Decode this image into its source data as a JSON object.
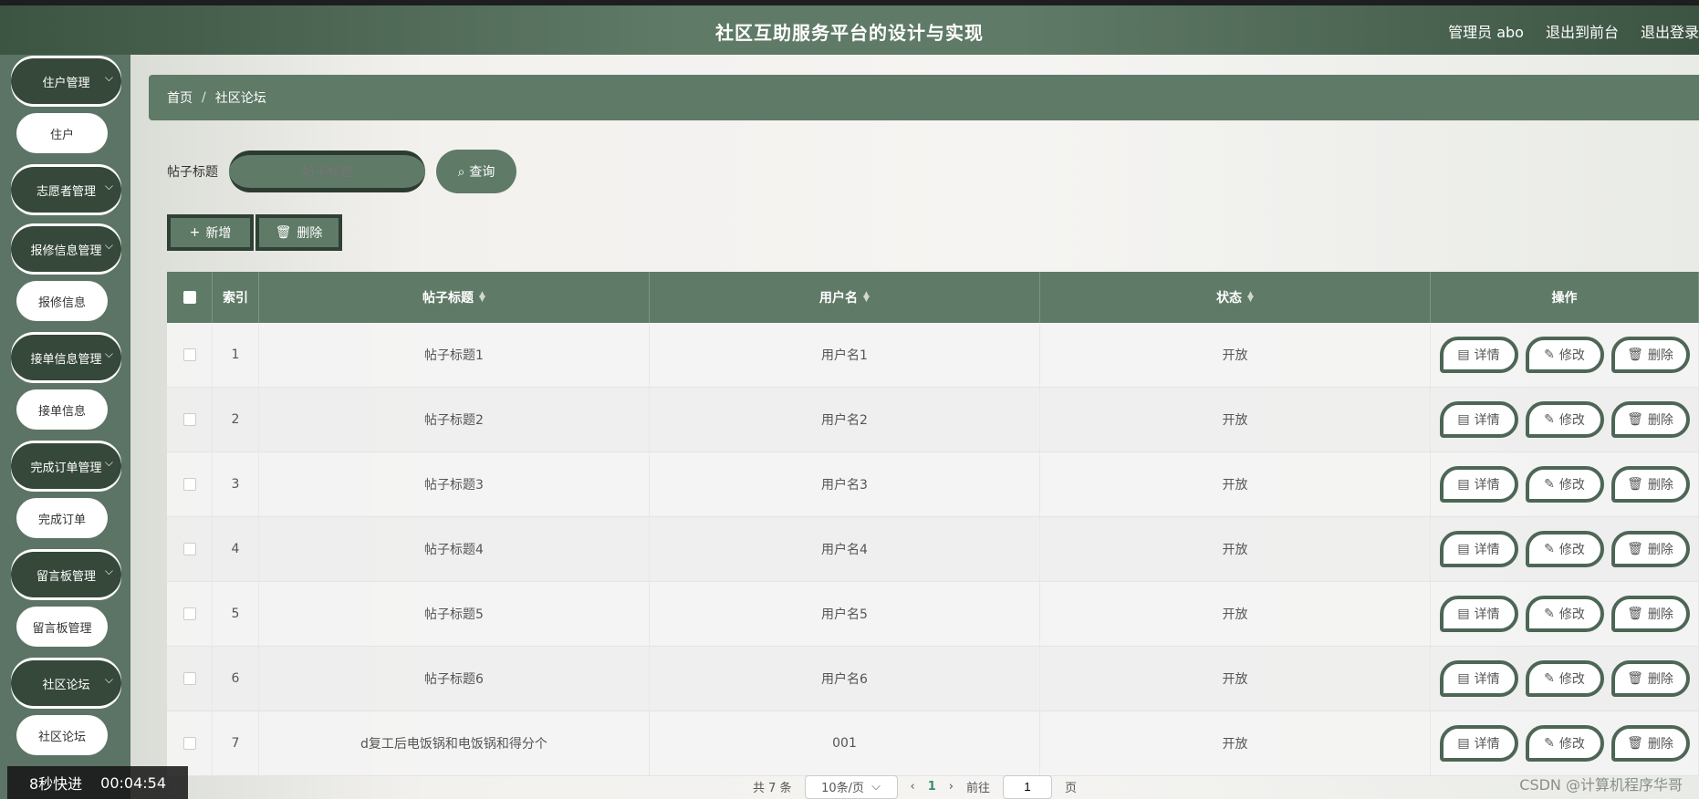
{
  "header": {
    "title": "社区互助服务平台的设计与实现",
    "user_label": "管理员 abo",
    "front_link": "退出到前台",
    "logout_link": "退出登录"
  },
  "sidebar": {
    "groups": [
      {
        "label": "住户管理",
        "sub": "住户"
      },
      {
        "label": "志愿者管理",
        "sub": null
      },
      {
        "label": "报修信息管理",
        "sub": "报修信息"
      },
      {
        "label": "接单信息管理",
        "sub": "接单信息"
      },
      {
        "label": "完成订单管理",
        "sub": "完成订单"
      },
      {
        "label": "留言板管理",
        "sub": "留言板管理"
      },
      {
        "label": "社区论坛",
        "sub": "社区论坛"
      }
    ]
  },
  "breadcrumb": {
    "home": "首页",
    "separator": "/",
    "current": "社区论坛"
  },
  "search": {
    "label": "帖子标题",
    "placeholder": "帖子标题",
    "button": "查询"
  },
  "actions": {
    "add": "新增",
    "delete": "删除"
  },
  "table": {
    "headers": {
      "index": "索引",
      "title": "帖子标题",
      "username": "用户名",
      "status": "状态",
      "ops": "操作"
    },
    "rows": [
      {
        "index": "1",
        "title": "帖子标题1",
        "username": "用户名1",
        "status": "开放"
      },
      {
        "index": "2",
        "title": "帖子标题2",
        "username": "用户名2",
        "status": "开放"
      },
      {
        "index": "3",
        "title": "帖子标题3",
        "username": "用户名3",
        "status": "开放"
      },
      {
        "index": "4",
        "title": "帖子标题4",
        "username": "用户名4",
        "status": "开放"
      },
      {
        "index": "5",
        "title": "帖子标题5",
        "username": "用户名5",
        "status": "开放"
      },
      {
        "index": "6",
        "title": "帖子标题6",
        "username": "用户名6",
        "status": "开放"
      },
      {
        "index": "7",
        "title": "d复工后电饭锅和电饭锅和得分个",
        "username": "001",
        "status": "开放"
      }
    ],
    "op_labels": {
      "detail": "详情",
      "edit": "修改",
      "delete": "删除"
    }
  },
  "pager": {
    "total": "共 7 条",
    "page_size": "10条/页",
    "current": "1",
    "goto_label": "前往",
    "goto_value": "1",
    "page_suffix": "页"
  },
  "overlay": {
    "speed": "8秒快进",
    "time": "00:04:54"
  },
  "watermark": "CSDN @计算机程序华哥",
  "colors": {
    "primary": "#5f7a67",
    "dark": "#35483a"
  }
}
